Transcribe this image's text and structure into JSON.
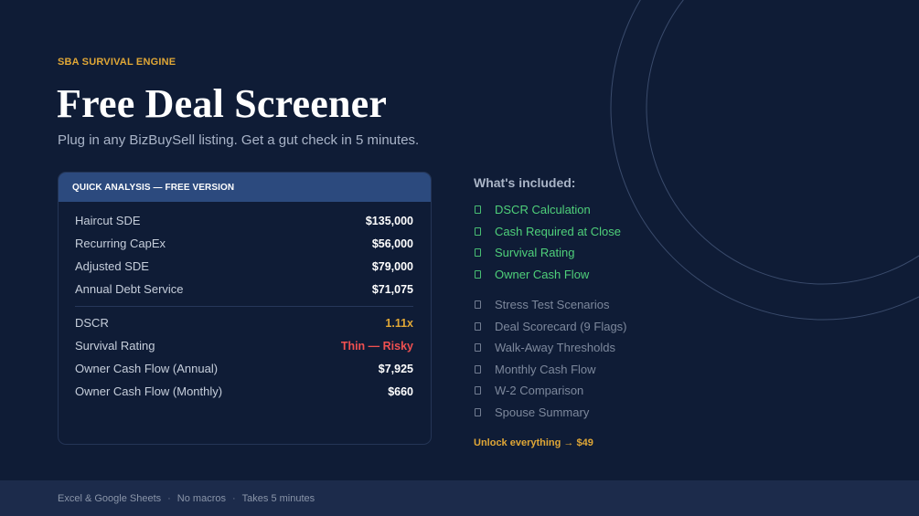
{
  "eyebrow": "SBA SURVIVAL ENGINE",
  "title": "Free Deal Screener",
  "subtitle": "Plug in any BizBuySell listing. Get a gut check in 5 minutes.",
  "card": {
    "header": "QUICK ANALYSIS — FREE VERSION",
    "rows_top": [
      {
        "label": "Haircut SDE",
        "value": "$135,000"
      },
      {
        "label": "Recurring CapEx",
        "value": "$56,000"
      },
      {
        "label": "Adjusted SDE",
        "value": "$79,000"
      },
      {
        "label": "Annual Debt Service",
        "value": "$71,075"
      }
    ],
    "rows_bottom": [
      {
        "label": "DSCR",
        "value": "1.11x"
      },
      {
        "label": "Survival Rating",
        "value": "Thin — Risky"
      },
      {
        "label": "Owner Cash Flow (Annual)",
        "value": "$7,925"
      },
      {
        "label": "Owner Cash Flow (Monthly)",
        "value": "$660"
      }
    ]
  },
  "included": {
    "heading": "What's included:",
    "free_items": [
      "DSCR Calculation",
      "Cash Required at Close",
      "Survival Rating",
      "Owner Cash Flow"
    ],
    "locked_items": [
      "Stress Test Scenarios",
      "Deal Scorecard (9 Flags)",
      "Walk-Away Thresholds",
      "Monthly Cash Flow",
      "W-2 Comparison",
      "Spouse Summary"
    ],
    "unlock": "Unlock everything → $49"
  },
  "footer": {
    "items": [
      "Excel & Google Sheets",
      "No macros",
      "Takes 5 minutes"
    ],
    "separator": "·"
  },
  "colors": {
    "background": "#0f1c36",
    "accent": "#e0a736",
    "success": "#4fd07a",
    "danger": "#ef5050",
    "card_header": "#2c4a7e"
  }
}
